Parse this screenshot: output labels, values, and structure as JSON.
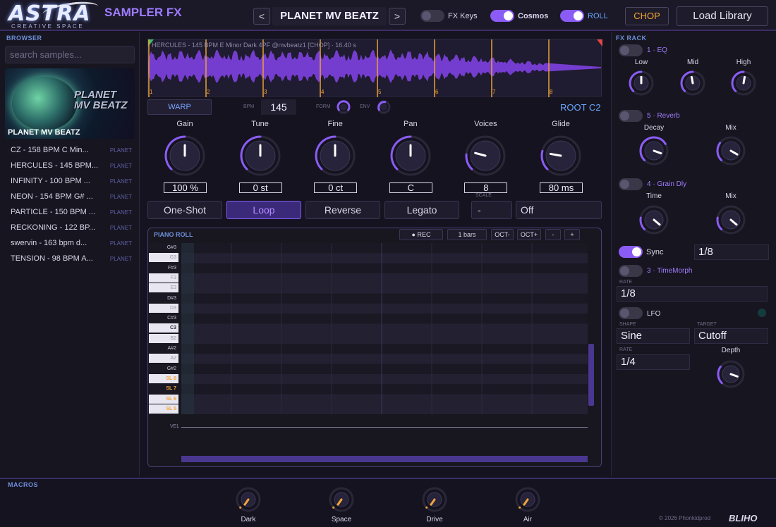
{
  "header": {
    "logo": "ASTRA",
    "logo_sub": "CREATIVE SPACE",
    "app_name": "SAMPLER FX",
    "prev": "<",
    "next": ">",
    "preset": "PLANET MV BEATZ",
    "toggles": [
      {
        "label": "FX Keys",
        "on": false
      },
      {
        "label": "Cosmos",
        "on": true
      },
      {
        "label": "ROLL",
        "on": true
      }
    ],
    "chop": "CHOP",
    "load": "Load Library"
  },
  "browser": {
    "title": "BROWSER",
    "search_placeholder": "search samples...",
    "cover_title": "PLANET MV BEATZ",
    "cover_art_text": "PLANET MV BEATZ",
    "samples": [
      {
        "name": "CZ - 158 BPM C Min...",
        "tag": "PLANET"
      },
      {
        "name": "HERCULES - 145 BPM...",
        "tag": "PLANET"
      },
      {
        "name": "INFINITY - 100 BPM ...",
        "tag": "PLANET"
      },
      {
        "name": "NEON - 154 BPM G# ...",
        "tag": "PLANET"
      },
      {
        "name": "PARTICLE - 150 BPM ...",
        "tag": "PLANET"
      },
      {
        "name": "RECKONING - 122 BP...",
        "tag": "PLANET"
      },
      {
        "name": "swervin - 163 bpm d...",
        "tag": "PLANET"
      },
      {
        "name": "TENSION - 98 BPM A...",
        "tag": "PLANET"
      }
    ]
  },
  "wave": {
    "info": "HERCULES - 145 BPM E Minor Dark 4PF @mvbeatz1 [CHOP] · 16.40 s",
    "beats": [
      "1",
      "2",
      "3",
      "4",
      "5",
      "6",
      "7",
      "8"
    ]
  },
  "controls": {
    "warp": "WARP",
    "bpm_label": "BPM",
    "bpm": "145",
    "form_label": "FORM",
    "env_label": "ENV",
    "root": "ROOT C2",
    "knobs": [
      {
        "label": "Gain",
        "value": "100 %"
      },
      {
        "label": "Tune",
        "value": "0 st"
      },
      {
        "label": "Fine",
        "value": "0 ct"
      },
      {
        "label": "Pan",
        "value": "C"
      },
      {
        "label": "Voices",
        "value": "8"
      },
      {
        "label": "Glide",
        "value": "80 ms"
      }
    ],
    "modes": [
      {
        "label": "One-Shot",
        "active": false
      },
      {
        "label": "Loop",
        "active": true
      },
      {
        "label": "Reverse",
        "active": false
      },
      {
        "label": "Legato",
        "active": false
      }
    ],
    "scale_label": "SCALE",
    "scale_value": "-",
    "scale_mode": "Off"
  },
  "piano_roll": {
    "title": "PIANO ROLL",
    "rec": "● REC",
    "bars": "1 bars",
    "oct_down": "OCT-",
    "oct_up": "OCT+",
    "minus": "-",
    "plus": "+",
    "keys": [
      {
        "label": "G#3",
        "type": "b"
      },
      {
        "label": "G3",
        "type": "w"
      },
      {
        "label": "F#3",
        "type": "b"
      },
      {
        "label": "F3",
        "type": "w"
      },
      {
        "label": "E3",
        "type": "w"
      },
      {
        "label": "D#3",
        "type": "b"
      },
      {
        "label": "D3",
        "type": "w"
      },
      {
        "label": "C#3",
        "type": "b"
      },
      {
        "label": "C3",
        "type": "w"
      },
      {
        "label": "B2",
        "type": "w"
      },
      {
        "label": "A#2",
        "type": "b"
      },
      {
        "label": "A2",
        "type": "w"
      },
      {
        "label": "G#2",
        "type": "b"
      },
      {
        "label": "SL 8",
        "type": "w"
      },
      {
        "label": "SL 7",
        "type": "b"
      },
      {
        "label": "SL 6",
        "type": "w"
      },
      {
        "label": "SL 5",
        "type": "w"
      }
    ],
    "vel": "VEL"
  },
  "fx_rack": {
    "title": "FX RACK",
    "eq": {
      "name": "1 · EQ",
      "knobs": [
        "Low",
        "Mid",
        "High"
      ]
    },
    "reverb": {
      "name": "5 · Reverb",
      "knobs": [
        "Decay",
        "Mix"
      ]
    },
    "grain": {
      "name": "4 · Grain Dly",
      "knobs": [
        "Time",
        "Mix"
      ]
    },
    "sync_label": "Sync",
    "sync_value": "1/8",
    "timemorph": {
      "name": "3 · TimeMorph",
      "rate_label": "RATE",
      "rate": "1/8"
    },
    "lfo": {
      "name": "LFO",
      "shape_label": "SHAPE",
      "shape": "Sine",
      "target_label": "TARGET",
      "target": "Cutoff",
      "rate_label": "RATE",
      "rate": "1/4",
      "depth_label": "Depth"
    }
  },
  "macros": {
    "title": "MACROS",
    "items": [
      "Dark",
      "Space",
      "Drive",
      "Air"
    ]
  },
  "footer": {
    "copyright": "© 2026 Phonkidprod",
    "brand": "BLIHO"
  },
  "colors": {
    "accent": "#8a5cf5",
    "orange": "#f3a43a",
    "blue": "#6c8fd8"
  }
}
